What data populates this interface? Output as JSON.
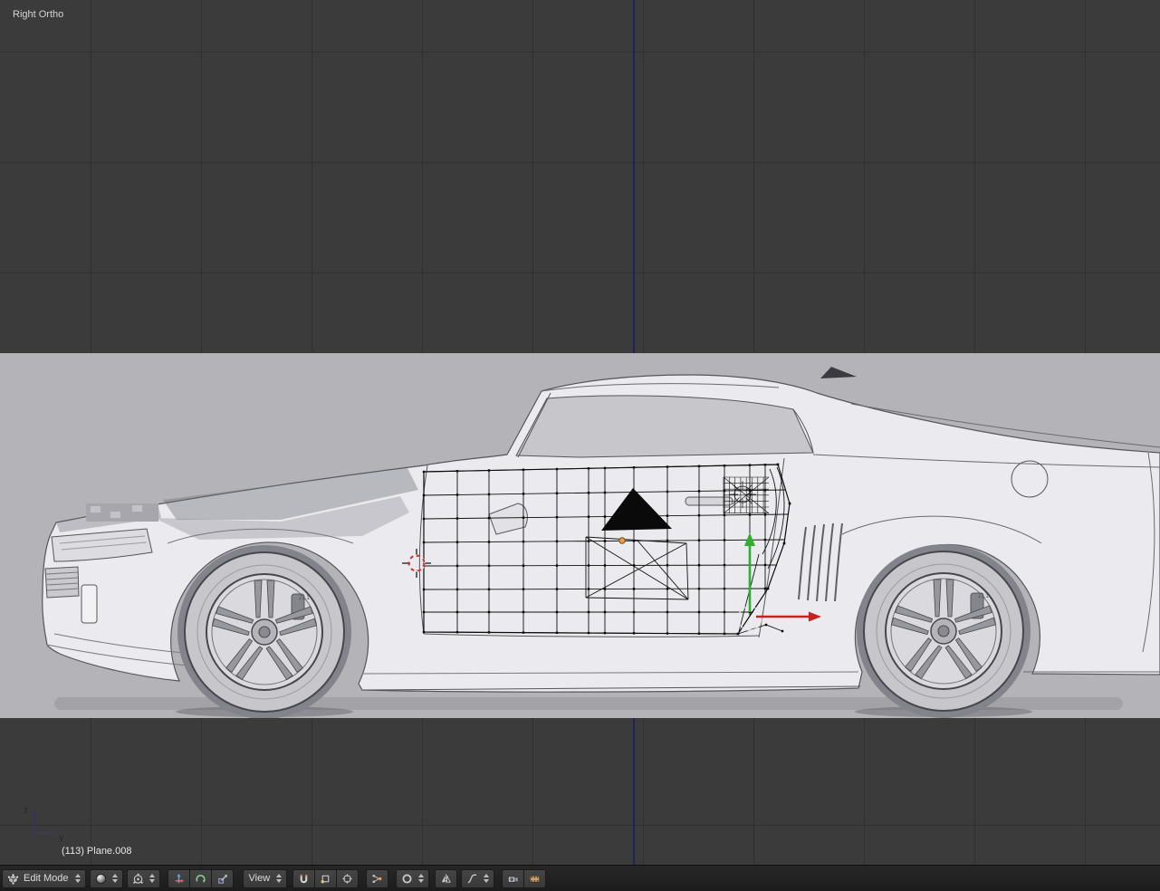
{
  "view": {
    "label": "Right Ortho"
  },
  "status_bar": {
    "object_info": "(113) Plane.008"
  },
  "mini_axis": {
    "z_label": "z",
    "y_label": "y"
  },
  "header": {
    "mode_dropdown": {
      "value": "Edit Mode"
    },
    "orientation_dropdown": {
      "value": "View"
    },
    "icons": [
      "edit-mode-icon",
      "viewport-shading-icon",
      "pivot-point-icon",
      "translate-manipulator-icon",
      "rotate-manipulator-icon",
      "scale-manipulator-icon",
      "magnet-icon",
      "vertex-snap-icon",
      "snap-target-icon",
      "automerge-icon",
      "proportional-editing-icon",
      "mirror-icon",
      "falloff-curve-icon",
      "camera-icon",
      "film-icon"
    ]
  },
  "reference_image": {
    "wheel_badge": "ZL1"
  },
  "colors": {
    "viewport_bg": "#3b3b3b",
    "grid_line": "#303030",
    "y_axis_line": "#20205c",
    "reference_bg": "#b4b4b8",
    "gizmo_z_green": "#2fae2f",
    "gizmo_y_red": "#c62222",
    "cursor_red": "#cc3333",
    "median_orange": "#e8a04a",
    "header_bg": "#202020"
  }
}
